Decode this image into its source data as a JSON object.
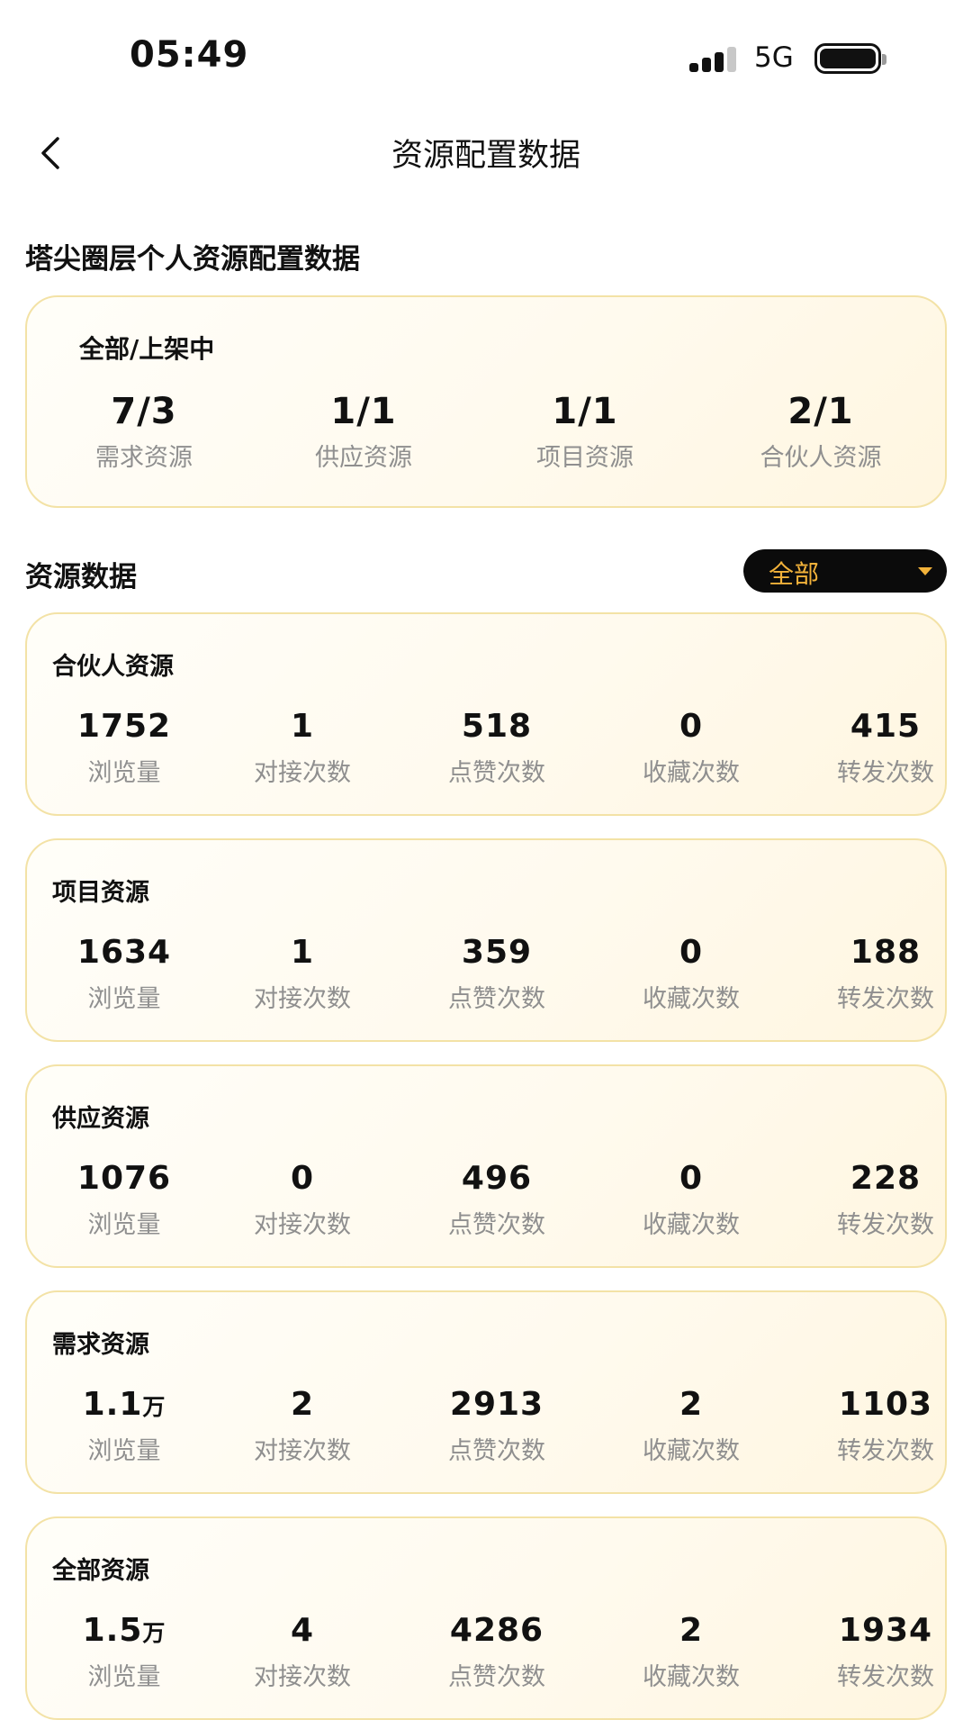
{
  "status_bar": {
    "time": "05:49",
    "network": "5G"
  },
  "nav": {
    "title": "资源配置数据"
  },
  "summary": {
    "section_title": "塔尖圈层个人资源配置数据",
    "label": "全部/上架中",
    "items": [
      {
        "value": "7/3",
        "label": "需求资源"
      },
      {
        "value": "1/1",
        "label": "供应资源"
      },
      {
        "value": "1/1",
        "label": "项目资源"
      },
      {
        "value": "2/1",
        "label": "合伙人资源"
      }
    ]
  },
  "resource_data": {
    "section_title": "资源数据",
    "filter": {
      "selected": "全部"
    },
    "stat_labels": [
      "浏览量",
      "对接次数",
      "点赞次数",
      "收藏次数",
      "转发次数"
    ],
    "cards": [
      {
        "title": "合伙人资源",
        "views": "1752",
        "views_unit": "",
        "connects": "1",
        "likes": "518",
        "favorites": "0",
        "shares": "415"
      },
      {
        "title": "项目资源",
        "views": "1634",
        "views_unit": "",
        "connects": "1",
        "likes": "359",
        "favorites": "0",
        "shares": "188"
      },
      {
        "title": "供应资源",
        "views": "1076",
        "views_unit": "",
        "connects": "0",
        "likes": "496",
        "favorites": "0",
        "shares": "228"
      },
      {
        "title": "需求资源",
        "views": "1.1",
        "views_unit": "万",
        "connects": "2",
        "likes": "2913",
        "favorites": "2",
        "shares": "1103"
      },
      {
        "title": "全部资源",
        "views": "1.5",
        "views_unit": "万",
        "connects": "4",
        "likes": "4286",
        "favorites": "2",
        "shares": "1934"
      }
    ]
  },
  "colors": {
    "accent": "#f2b23a",
    "card_border": "#f3e2a6",
    "muted_text": "#8f8f8f"
  }
}
